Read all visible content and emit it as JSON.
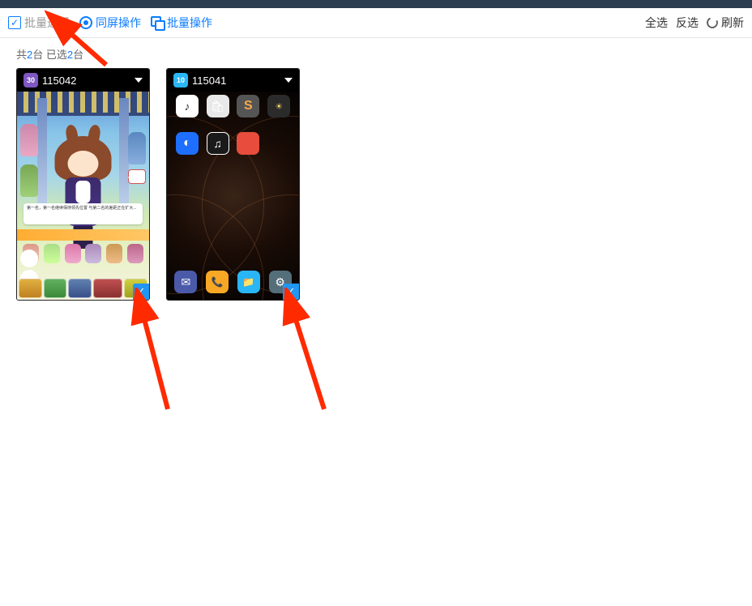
{
  "colors": {
    "accent": "#0a7cff",
    "arrow": "#ff2a00"
  },
  "toolbar": {
    "batch_select_label": "批量选择",
    "same_screen_label": "同屏操作",
    "batch_action_label": "批量操作",
    "select_all": "全选",
    "invert_select": "反选",
    "refresh": "刷新"
  },
  "status": {
    "prefix": "共",
    "count": "2",
    "mid": "台 已选",
    "selected": "2",
    "suffix": "台"
  },
  "devices": [
    {
      "id": "115042",
      "badge": "30",
      "badge_kind": "b30",
      "screen_type": "game",
      "selected": true,
      "game_dialog": "第一名，第一名继续保持领先位置\n与第二名的差距正在扩大..."
    },
    {
      "id": "115041",
      "badge": "10",
      "badge_kind": "b10",
      "screen_type": "home",
      "selected": true
    }
  ]
}
